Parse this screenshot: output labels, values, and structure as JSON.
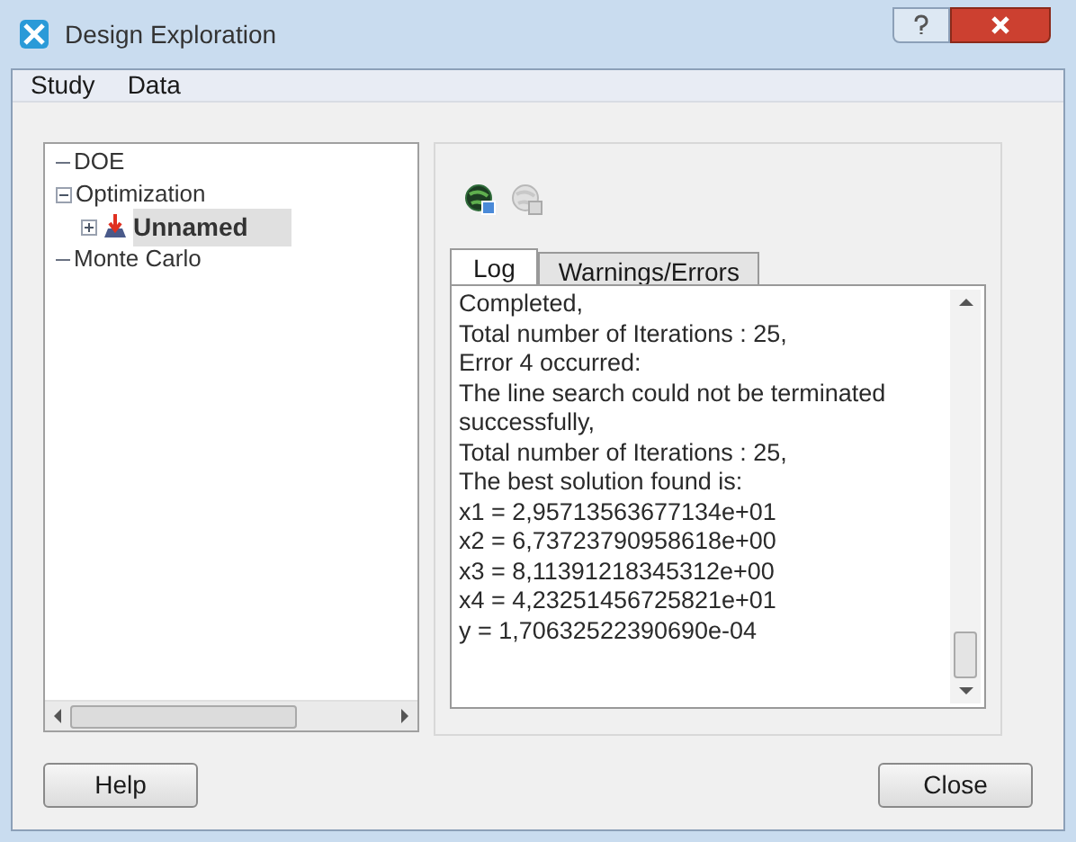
{
  "window": {
    "title": "Design Exploration"
  },
  "menu": [
    {
      "label": "Study"
    },
    {
      "label": "Data"
    }
  ],
  "tree": [
    {
      "label": "DOE"
    },
    {
      "label": "Optimization",
      "expanded": true,
      "children": [
        {
          "label": "Unnamed",
          "expanded": false,
          "selected": true
        }
      ]
    },
    {
      "label": "Monte Carlo"
    }
  ],
  "toolbar": [
    {
      "disabled": false
    },
    {
      "disabled": true
    }
  ],
  "tabs": [
    {
      "label": "Log",
      "selected": true
    },
    {
      "label": "Warnings/Errors",
      "selected": false
    }
  ],
  "log": [
    "Completed,",
    "Total number of Iterations : 25,",
    "Error 4 occurred:",
    "The line search could not be terminated successfully,",
    "Total number of Iterations : 25,",
    "The best solution found is:",
    "x1 = 2,95713563677134e+01",
    "x2 = 6,73723790958618e+00",
    "x3 = 8,11391218345312e+00",
    "x4 = 4,23251456725821e+01",
    "y = 1,70632522390690e-04"
  ],
  "buttons": [
    {
      "label": "Help"
    },
    {
      "label": "Close"
    }
  ]
}
